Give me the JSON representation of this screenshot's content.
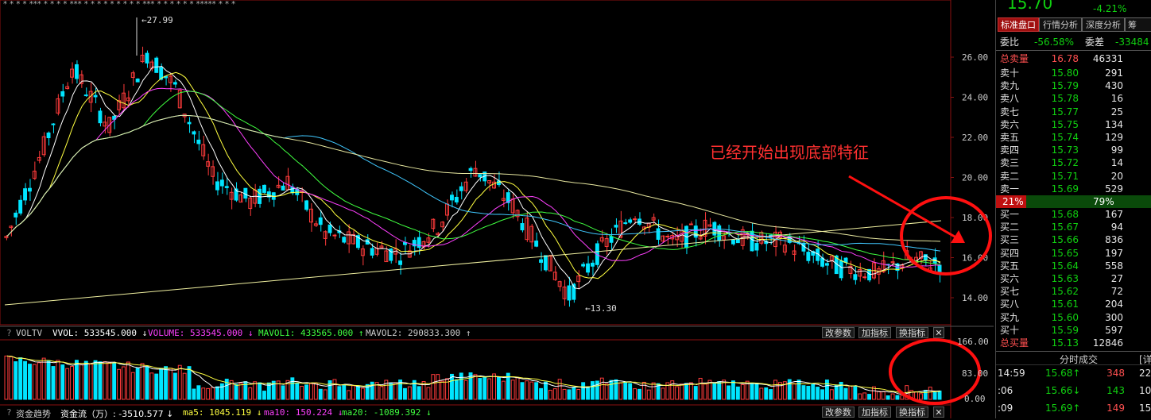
{
  "chart": {
    "axis_prices": [
      "26.00",
      "24.00",
      "22.00",
      "20.00",
      "18.00",
      "16.00",
      "14.00"
    ],
    "high_label": "27.99",
    "low_label": "13.30",
    "annotation": "已经开始出现底部特征",
    "colors": {
      "up": "#ff3b3b",
      "down": "#00e5ff",
      "ma5": "#ffffff",
      "ma10": "#ffff40",
      "ma20": "#ff40ff",
      "ma30": "#40ff40",
      "ma60": "#40c8ff",
      "ma120": "#e8e8a0",
      "circle": "#ff1010"
    }
  },
  "volume_panel": {
    "question_mark": "?",
    "title": "VOLTV",
    "vvol": "VVOL: 533545.000 ↓",
    "volume": "VOLUME: 533545.000 ↓",
    "mavol1": "MAVOL1: 433565.000 ↑",
    "mavol2": "MAVOL2: 290833.300 ↑",
    "axis": [
      "166.00",
      "83.00",
      "0.00"
    ]
  },
  "fund_panel": {
    "question_mark": "?",
    "title": "资金趋势",
    "flow": "资金流（万）: -3510.577 ↓",
    "ma5": "ma5: 1045.119 ↓",
    "ma10": "ma10: 150.224 ↓",
    "ma20": "ma20: -1089.392 ↓"
  },
  "buttons": {
    "modify": "改参数",
    "add": "加指标",
    "swap": "换指标",
    "close": "✕"
  },
  "panel": {
    "price": "15.70",
    "change_pct": "-4.21%",
    "tabs": [
      "标准盘口",
      "行情分析",
      "深度分析",
      "筹"
    ],
    "weibi_label": "委比",
    "weibi_value": "-56.58%",
    "weicha_label": "委差",
    "weicha_value": "-33484",
    "total_sell_label": "总卖量",
    "total_sell_price": "16.78",
    "total_sell_vol": "46331",
    "asks": [
      {
        "label": "卖十",
        "price": "15.80",
        "vol": "291"
      },
      {
        "label": "卖九",
        "price": "15.79",
        "vol": "430"
      },
      {
        "label": "卖八",
        "price": "15.78",
        "vol": "16"
      },
      {
        "label": "卖七",
        "price": "15.77",
        "vol": "25"
      },
      {
        "label": "卖六",
        "price": "15.75",
        "vol": "134"
      },
      {
        "label": "卖五",
        "price": "15.74",
        "vol": "129"
      },
      {
        "label": "卖四",
        "price": "15.73",
        "vol": "99"
      },
      {
        "label": "卖三",
        "price": "15.72",
        "vol": "14"
      },
      {
        "label": "卖二",
        "price": "15.71",
        "vol": "20"
      },
      {
        "label": "卖一",
        "price": "15.69",
        "vol": "529"
      }
    ],
    "ratio_left": "21%",
    "ratio_right": "79%",
    "bids": [
      {
        "label": "买一",
        "price": "15.68",
        "vol": "167"
      },
      {
        "label": "买二",
        "price": "15.67",
        "vol": "94"
      },
      {
        "label": "买三",
        "price": "15.66",
        "vol": "836"
      },
      {
        "label": "买四",
        "price": "15.65",
        "vol": "197"
      },
      {
        "label": "买五",
        "price": "15.64",
        "vol": "558"
      },
      {
        "label": "买六",
        "price": "15.63",
        "vol": "27"
      },
      {
        "label": "买七",
        "price": "15.62",
        "vol": "72"
      },
      {
        "label": "买八",
        "price": "15.61",
        "vol": "204"
      },
      {
        "label": "买九",
        "price": "15.60",
        "vol": "300"
      },
      {
        "label": "买十",
        "price": "15.59",
        "vol": "597"
      }
    ],
    "total_buy_label": "总买量",
    "total_buy_price": "15.13",
    "total_buy_vol": "12846",
    "ticks_title": "分时成交",
    "ticks_detail": "[详",
    "ticks": [
      {
        "time": "14:59",
        "price": "15.68↑",
        "vol": "348",
        "n": "22"
      },
      {
        "time": ":06",
        "price": "15.66↓",
        "vol": "143",
        "n": "10"
      },
      {
        "time": ":09",
        "price": "15.69↑",
        "vol": "149",
        "n": "15"
      }
    ]
  }
}
